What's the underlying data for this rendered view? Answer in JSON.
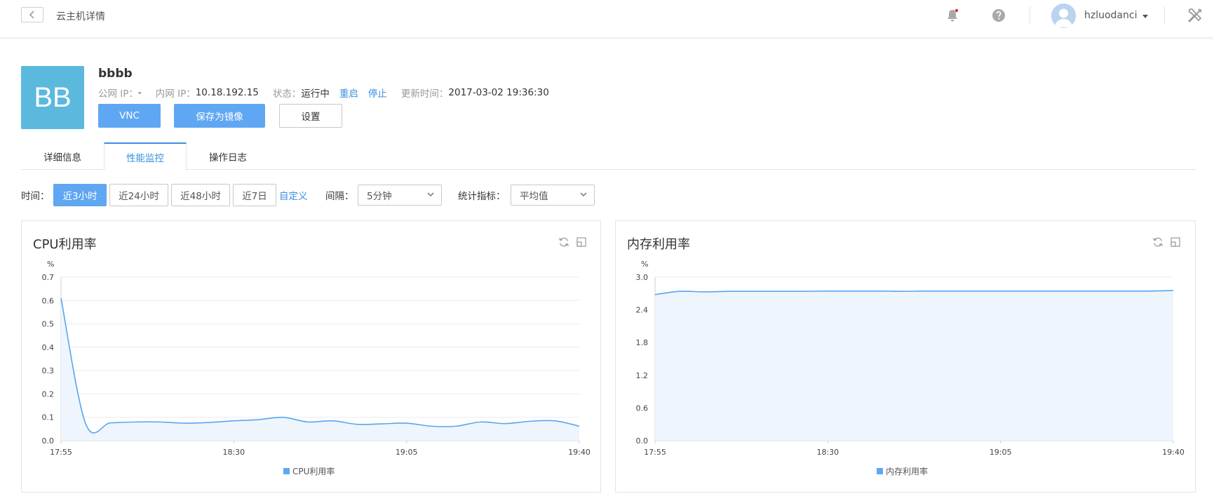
{
  "header": {
    "title": "云主机详情",
    "username": "hzluodanci",
    "notification_color": "#e02d2d"
  },
  "instance": {
    "logo_text": "BB",
    "name": "bbbb",
    "public_ip_label": "公网 IP：",
    "public_ip_value": "-",
    "private_ip_label": "内网 IP：",
    "private_ip_value": "10.18.192.15",
    "status_label": "状态：",
    "status_value": "运行中",
    "restart_label": "重启",
    "stop_label": "停止",
    "updated_label": "更新时间：",
    "updated_value": "2017-03-02 19:36:30",
    "buttons": {
      "vnc": "VNC",
      "save_image": "保存为镜像",
      "settings": "设置"
    }
  },
  "tabs": [
    {
      "label": "详细信息",
      "active": false
    },
    {
      "label": "性能监控",
      "active": true
    },
    {
      "label": "操作日志",
      "active": false
    }
  ],
  "filters": {
    "time_label": "时间：",
    "time_options": [
      "近3小时",
      "近24小时",
      "近48小时",
      "近7日"
    ],
    "time_active": "近3小时",
    "custom_label": "自定义",
    "interval_label": "间隔：",
    "interval_value": "5分钟",
    "metric_label": "统计指标：",
    "metric_value": "平均值"
  },
  "colors": {
    "accent": "#5fa7f2",
    "link": "#3b8fe0",
    "logo_bg": "#5bb9de",
    "line": "#5aa5ef",
    "area": "#eef5fd"
  },
  "chart_data": [
    {
      "type": "area",
      "title": "CPU利用率",
      "ylabel": "%",
      "ylim": [
        0,
        0.7
      ],
      "y_ticks": [
        "0.0",
        "0.1",
        "0.2",
        "0.3",
        "0.4",
        "0.5",
        "0.6",
        "0.7"
      ],
      "x_tick_labels": [
        "17:55",
        "18:30",
        "19:05",
        "19:40"
      ],
      "grid": true,
      "legend_position": "bottom",
      "series": [
        {
          "name": "CPU利用率",
          "x": [
            "17:55",
            "18:00",
            "18:05",
            "18:10",
            "18:15",
            "18:20",
            "18:25",
            "18:30",
            "18:35",
            "18:40",
            "18:45",
            "18:50",
            "18:55",
            "19:00",
            "19:05",
            "19:10",
            "19:15",
            "19:20",
            "19:25",
            "19:30",
            "19:35",
            "19:40"
          ],
          "values": [
            0.61,
            0.072,
            0.076,
            0.08,
            0.08,
            0.075,
            0.078,
            0.085,
            0.09,
            0.1,
            0.08,
            0.085,
            0.07,
            0.072,
            0.075,
            0.062,
            0.062,
            0.08,
            0.073,
            0.083,
            0.085,
            0.062
          ]
        }
      ]
    },
    {
      "type": "area",
      "title": "内存利用率",
      "ylabel": "%",
      "ylim": [
        0,
        3.0
      ],
      "y_ticks": [
        "0.0",
        "0.6",
        "1.2",
        "1.8",
        "2.4",
        "3.0"
      ],
      "x_tick_labels": [
        "17:55",
        "18:30",
        "19:05",
        "19:40"
      ],
      "grid": true,
      "legend_position": "bottom",
      "series": [
        {
          "name": "内存利用率",
          "x": [
            "17:55",
            "18:00",
            "18:05",
            "18:10",
            "18:15",
            "18:20",
            "18:25",
            "18:30",
            "18:35",
            "18:40",
            "18:45",
            "18:50",
            "18:55",
            "19:00",
            "19:05",
            "19:10",
            "19:15",
            "19:20",
            "19:25",
            "19:30",
            "19:35",
            "19:40"
          ],
          "values": [
            2.68,
            2.74,
            2.73,
            2.74,
            2.74,
            2.74,
            2.74,
            2.745,
            2.745,
            2.745,
            2.74,
            2.745,
            2.745,
            2.745,
            2.745,
            2.745,
            2.745,
            2.745,
            2.745,
            2.745,
            2.745,
            2.755
          ]
        }
      ]
    }
  ]
}
